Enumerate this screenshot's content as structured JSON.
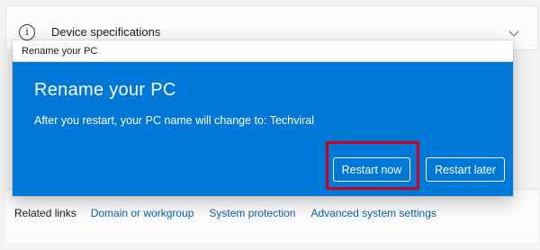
{
  "background": {
    "spec_row": {
      "label": "Device specifications",
      "icon": "info-icon"
    },
    "related": {
      "label": "Related links",
      "links": [
        "Domain or workgroup",
        "System protection",
        "Advanced system settings"
      ]
    }
  },
  "dialog": {
    "window_title": "Rename your PC",
    "heading": "Rename your PC",
    "message": "After you restart, your PC name will change to: Techviral",
    "buttons": {
      "restart_now": "Restart now",
      "restart_later": "Restart later"
    }
  },
  "colors": {
    "dialog_blue": "#0078d7",
    "highlight_red": "#d0021b",
    "link_blue": "#0a5fb0"
  }
}
